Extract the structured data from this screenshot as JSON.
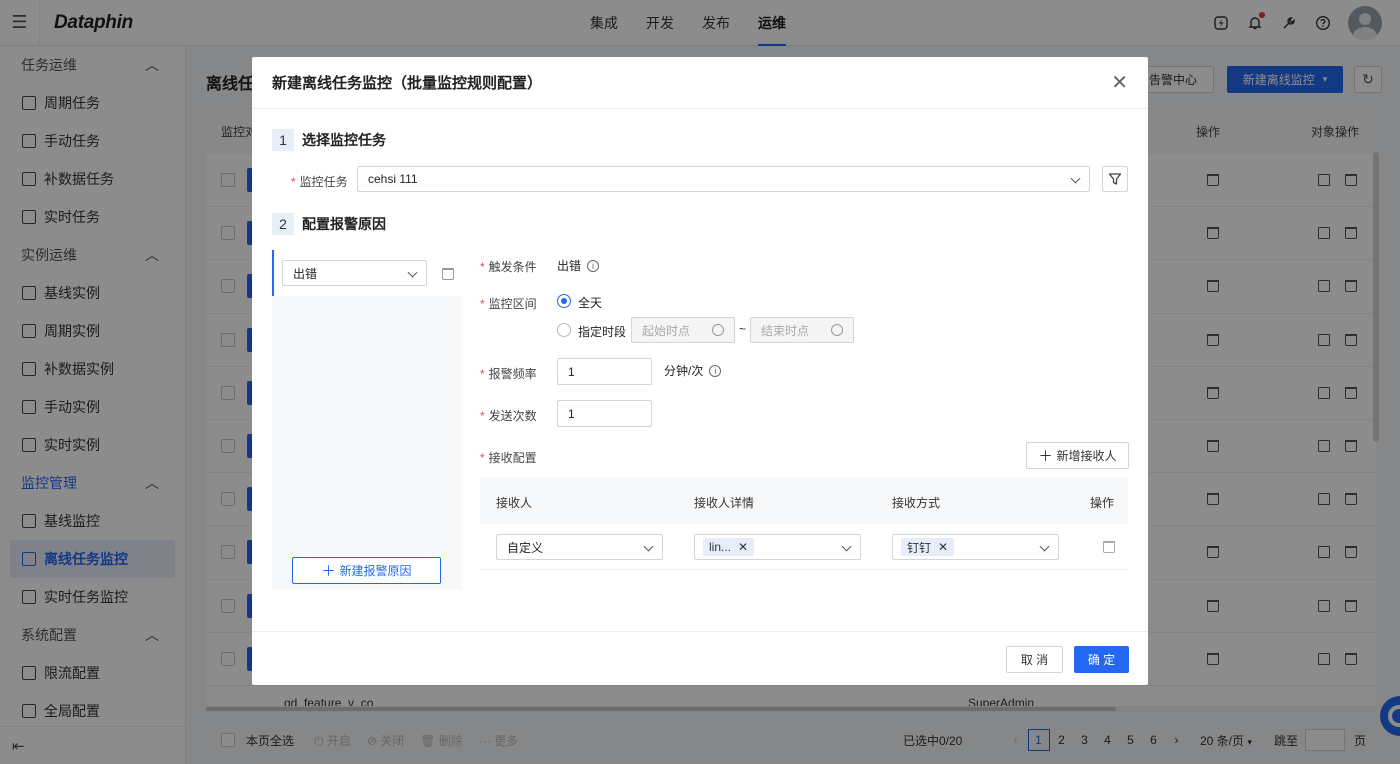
{
  "app": {
    "logo": "Dataphin"
  },
  "nav": {
    "items": [
      "集成",
      "开发",
      "发布",
      "运维"
    ],
    "active": "运维"
  },
  "sidebar": {
    "groups": [
      {
        "label": "任务运维",
        "items": [
          "周期任务",
          "手动任务",
          "补数据任务",
          "实时任务"
        ]
      },
      {
        "label": "实例运维",
        "items": [
          "基线实例",
          "周期实例",
          "补数据实例",
          "手动实例",
          "实时实例"
        ]
      },
      {
        "label": "监控管理",
        "items": [
          "基线监控",
          "离线任务监控",
          "实时任务监控"
        ]
      },
      {
        "label": "系统配置",
        "items": [
          "限流配置",
          "全局配置"
        ]
      }
    ],
    "active_item": "离线任务监控"
  },
  "background": {
    "page_title": "离线任",
    "alarm_center": "告警中心",
    "new_monitor": "新建离线监控",
    "col_monitor": "监控对",
    "col_ops": "操作",
    "col_obj_ops": "对象操作",
    "last_row_name": "gd_feature_v_co",
    "last_row_owner": "SuperAdmin",
    "footer": {
      "select_all": "本页全选",
      "enable": "开启",
      "close": "关闭",
      "delete": "删除",
      "more": "更多",
      "selected": "已选中0/20",
      "pages": [
        "1",
        "2",
        "3",
        "4",
        "5",
        "6"
      ],
      "page_size": "20 条/页",
      "jump": "跳至",
      "page_unit": "页"
    }
  },
  "modal": {
    "title": "新建离线任务监控（批量监控规则配置）",
    "step1": {
      "num": "1",
      "title": "选择监控任务"
    },
    "step2": {
      "num": "2",
      "title": "配置报警原因"
    },
    "monitor_task_label": "监控任务",
    "monitor_task_value": "cehsi 111",
    "reason_select": "出错",
    "add_reason": "新建报警原因",
    "trigger_label": "触发条件",
    "trigger_value": "出错",
    "range_label": "监控区间",
    "range_all": "全天",
    "range_period": "指定时段",
    "start_placeholder": "起始时点",
    "end_placeholder": "结束时点",
    "range_sep": "~",
    "freq_label": "报警频率",
    "freq_value": "1",
    "freq_unit": "分钟/次",
    "count_label": "发送次数",
    "count_value": "1",
    "receive_label": "接收配置",
    "add_receiver": "新增接收人",
    "table": {
      "headers": [
        "接收人",
        "接收人详情",
        "接收方式",
        "操作"
      ],
      "row": {
        "receiver": "自定义",
        "detail_tag": "lin...",
        "method_tag": "钉钉"
      }
    },
    "cancel": "取 消",
    "confirm": "确 定"
  },
  "colors": {
    "accent": "#2468f2",
    "required": "#e5484d"
  }
}
